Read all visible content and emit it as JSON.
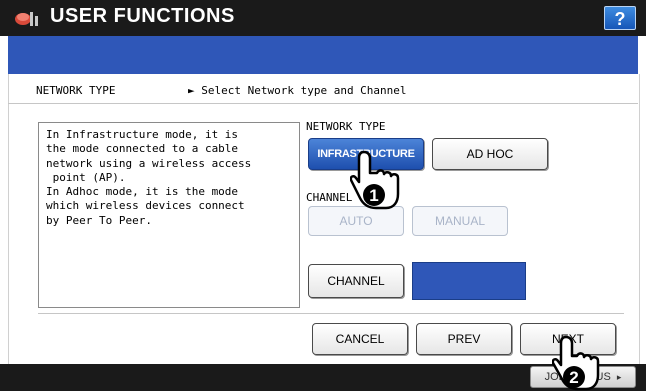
{
  "window": {
    "title": "USER FUNCTIONS",
    "help_label": "?"
  },
  "header": {
    "label": "NETWORK TYPE",
    "description": "► Select Network type and Channel"
  },
  "info": {
    "text": "In Infrastructure mode, it is\nthe mode connected to a cable\nnetwork using a wireless access\n point (AP).\nIn Adhoc mode, it is the mode\nwhich wireless devices connect\nby Peer To Peer."
  },
  "network_type": {
    "label": "NETWORK TYPE",
    "options": [
      {
        "label": "INFRASTRUCTURE",
        "selected": true
      },
      {
        "label": "AD HOC",
        "selected": false
      }
    ]
  },
  "channel": {
    "label": "CHANNEL",
    "auto_label": "AUTO",
    "manual_label": "MANUAL",
    "channel_button_label": "CHANNEL"
  },
  "footer": {
    "cancel_label": "CANCEL",
    "prev_label": "PREV",
    "next_label": "NEXT"
  },
  "status": {
    "job_status_label": "JOB STATUS"
  },
  "callouts": {
    "step1": "1",
    "step2": "2"
  },
  "colors": {
    "accent": "#2f57b8",
    "titlebar": "#1a1a1a",
    "selected_button": "#1e4fae"
  }
}
